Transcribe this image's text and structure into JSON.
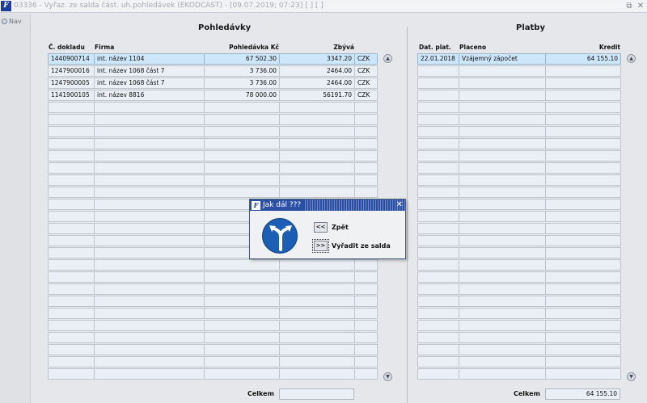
{
  "window": {
    "title": "03336 - Vyřaz. ze salda část. uh.pohledávek (EKODCAST) - [09.07.2019; 07:23]  [ ]  [ ]",
    "logo_text": "F",
    "restore_icon": "restore-icon",
    "close_icon": "close-icon"
  },
  "nav": {
    "label": "Nav",
    "icon": "nav-dot-icon"
  },
  "left_panel": {
    "title": "Pohledávky",
    "headers": [
      "Č. dokladu",
      "Firma",
      "Pohledávka Kč",
      "Zbývá",
      ""
    ],
    "rows": [
      [
        "1440900714",
        "int. název 1104",
        "67 502.30",
        "3347.20",
        "CZK"
      ],
      [
        "1247900016",
        "int. název 1068 část 7",
        "3 736.00",
        "2464.00",
        "CZK"
      ],
      [
        "1247900005",
        "int. název 1068 část 7",
        "3 736.00",
        "2464.00",
        "CZK"
      ],
      [
        "1141900105",
        "int. název 8816",
        "78 000.00",
        "56191.70",
        "CZK"
      ]
    ],
    "selected_row": 0,
    "total_label": "Celkem",
    "total_value": ""
  },
  "right_panel": {
    "title": "Platby",
    "headers": [
      "Dat. plat.",
      "Placeno",
      "Kredit"
    ],
    "rows": [
      [
        "22.01.2018",
        "Vzájemný zápočet",
        "64 155.10"
      ]
    ],
    "selected_row": 0,
    "total_label": "Celkem",
    "total_value": "64 155.10"
  },
  "dialog": {
    "title": "Jak dál ???",
    "icon": "fork-arrows-sign-icon",
    "back_button": "<<",
    "back_label": "Zpět",
    "remove_button": ">>",
    "remove_label": "Vyřadit ze salda",
    "close_icon": "close-icon"
  },
  "colors": {
    "selection": "#cde6fa",
    "cell_bg": "#e9eff4",
    "dialog_title": "#2b4fa3",
    "sign_blue": "#1b5eb6"
  }
}
